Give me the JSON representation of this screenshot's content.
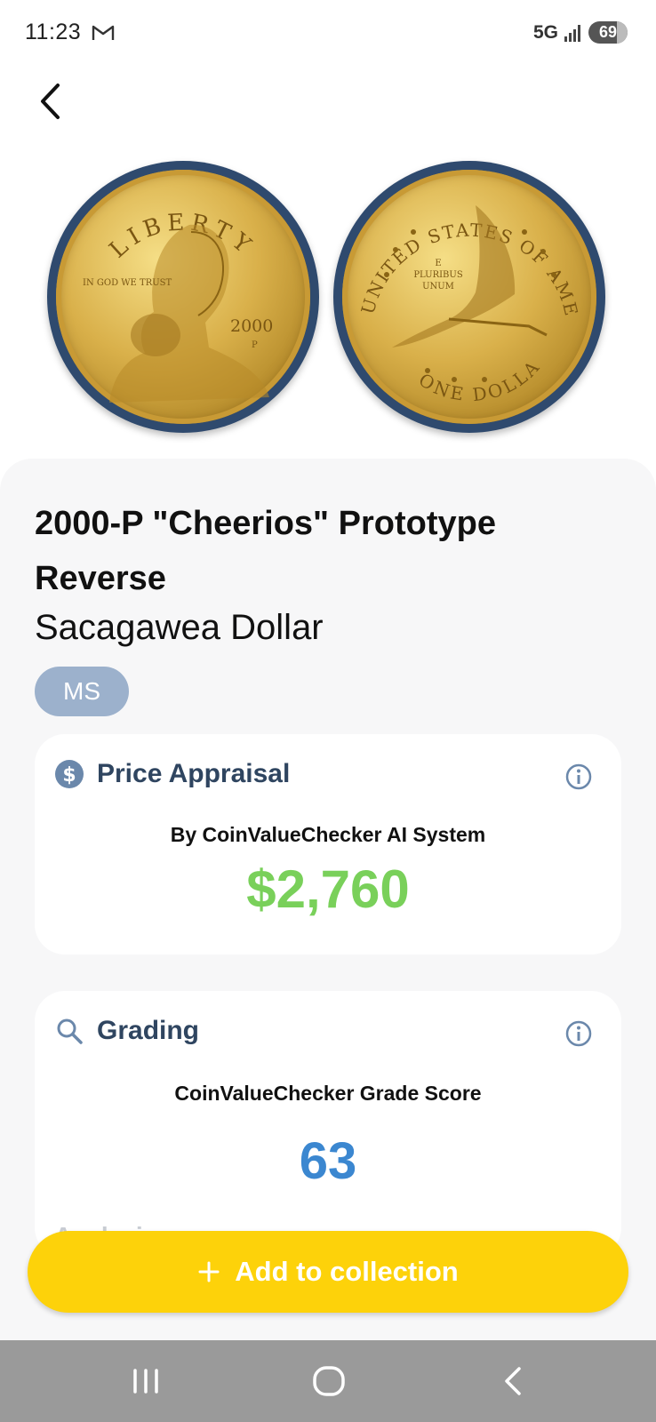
{
  "status_bar": {
    "time": "11:23",
    "network": "5G",
    "battery": "69",
    "icons": [
      "gmail-icon",
      "signal-icon",
      "battery-icon"
    ]
  },
  "navigation": {
    "back_icon": "chevron-left-icon"
  },
  "coin_images": {
    "obverse": {
      "legend": "LIBERTY",
      "motto": "IN GOD WE TRUST",
      "year": "2000",
      "mint_mark": "P"
    },
    "reverse": {
      "legend": "UNITED STATES OF AMERICA",
      "motto_line1": "E",
      "motto_line2": "PLURIBUS",
      "motto_line3": "UNUM",
      "denomination": "ONE DOLLAR"
    }
  },
  "coin": {
    "title": "2000-P \"Cheerios\" Prototype Reverse",
    "series": "Sacagawea Dollar",
    "grade_badge": "MS"
  },
  "price_card": {
    "title": "Price Appraisal",
    "icon": "dollar-icon",
    "subtitle": "By CoinValueChecker AI System",
    "value": "$2,760",
    "value_color": "#79d05a"
  },
  "grading_card": {
    "title": "Grading",
    "icon": "search-icon",
    "subtitle": "CoinValueChecker Grade Score",
    "score": "63",
    "score_color": "#3b87d0",
    "analysis_label": "Analysis"
  },
  "actions": {
    "add_label": "Add to collection",
    "add_color": "#fdd20a"
  },
  "system_nav": {
    "icons": [
      "recents-icon",
      "home-icon",
      "back-icon"
    ]
  }
}
